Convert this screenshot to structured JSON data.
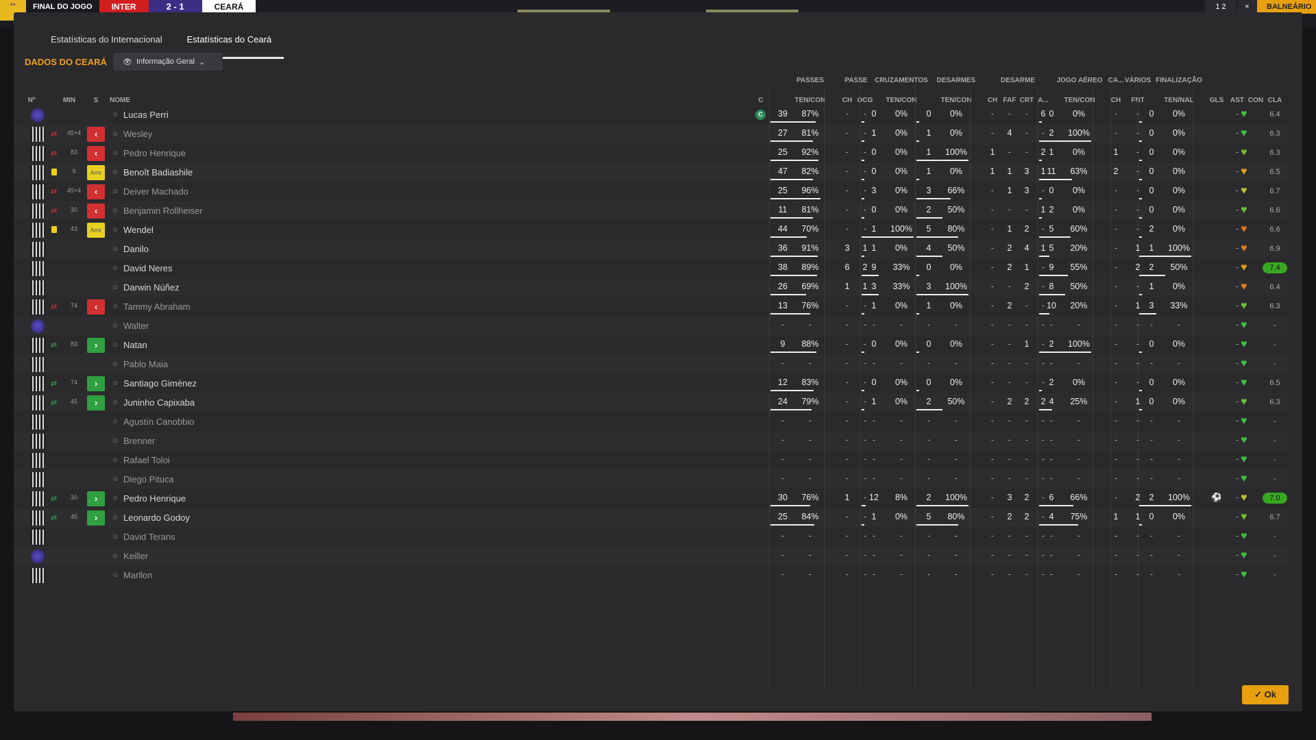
{
  "topbar": {
    "final_label": "FINAL DO JOGO",
    "home_team": "INTER",
    "score": "2 - 1",
    "away_team": "CEARÁ",
    "right_num": "1 2",
    "right_x": "×",
    "right_button": "BALNEÁRIO"
  },
  "tabs": [
    {
      "label": "Estatísticas do Internacional"
    },
    {
      "label": "Estatísticas do Ceará"
    }
  ],
  "section_title": "DADOS DO CEARÁ",
  "dropdown": {
    "label": "Informação Geral"
  },
  "groups": {
    "passes": "PASSES",
    "passe": "PASSE",
    "cruz": "CRUZAMENTOS",
    "desarmes": "DESARMES",
    "desarme": "DESARME",
    "aereo": "JOGO AÉREO",
    "ca": "CA...",
    "varios": "VÁRIOS",
    "final": "FINALIZAÇÃO"
  },
  "headers": {
    "num": "Nº",
    "min": "MIN",
    "s": "S",
    "nome": "NOME",
    "c": "C",
    "passes_tc": "TEN/CON",
    "ch": "CH",
    "ocg": "OCG",
    "cruz_tc": "TEN/CON",
    "des_tc": "TEN/CON",
    "d_ch": "CH",
    "faf": "FAF",
    "crt": "CRT",
    "a": "A...",
    "aer_tc": "TEN/CON",
    "ca_ch": "CH",
    "fnt": "FNT",
    "fin_tn": "TEN/NAL",
    "gls": "GLS",
    "ast": "AST",
    "con": "CON",
    "cla": "CLA"
  },
  "players": [
    {
      "name": "Lucas Perri",
      "kit": "gk",
      "min": "",
      "s": "",
      "card": false,
      "capt": "C",
      "p": [
        "39",
        "87%"
      ],
      "pch": "-",
      "ocg": "-",
      "cr": [
        "0",
        "0%"
      ],
      "de": [
        "0",
        "0%"
      ],
      "dch": "-",
      "faf": "-",
      "crt": "-",
      "da": "6",
      "ae": [
        "0",
        "0%"
      ],
      "cach": "-",
      "fnt": "-",
      "fi": [
        "0",
        "0%"
      ],
      "gls": "",
      "ast": "-",
      "con": "#40c040",
      "cla": "6.4",
      "hi": false,
      "bench": false
    },
    {
      "name": "Wesley",
      "kit": "out",
      "min": "45+4",
      "s": "off",
      "card": false,
      "capt": "",
      "p": [
        "27",
        "81%"
      ],
      "pch": "-",
      "ocg": "-",
      "cr": [
        "1",
        "0%"
      ],
      "de": [
        "1",
        "0%"
      ],
      "dch": "-",
      "faf": "4",
      "crt": "-",
      "da": "-",
      "ae": [
        "2",
        "100%"
      ],
      "cach": "-",
      "fnt": "-",
      "fi": [
        "0",
        "0%"
      ],
      "gls": "",
      "ast": "-",
      "con": "#40c040",
      "cla": "6.3",
      "hi": false,
      "bench": true
    },
    {
      "name": "Pedro Henrique",
      "kit": "out",
      "min": "83",
      "s": "off",
      "card": false,
      "capt": "",
      "p": [
        "25",
        "92%"
      ],
      "pch": "-",
      "ocg": "-",
      "cr": [
        "0",
        "0%"
      ],
      "de": [
        "1",
        "100%"
      ],
      "dch": "1",
      "faf": "-",
      "crt": "-",
      "da": "2",
      "ae": [
        "1",
        "0%"
      ],
      "cach": "1",
      "fnt": "-",
      "fi": [
        "0",
        "0%"
      ],
      "gls": "",
      "ast": "-",
      "con": "#70c030",
      "cla": "6.3",
      "hi": false,
      "bench": true
    },
    {
      "name": "Benoît Badiashile",
      "kit": "out",
      "min": "9",
      "s": "amr",
      "card": true,
      "capt": "",
      "p": [
        "47",
        "82%"
      ],
      "pch": "-",
      "ocg": "-",
      "cr": [
        "0",
        "0%"
      ],
      "de": [
        "1",
        "0%"
      ],
      "dch": "1",
      "faf": "1",
      "crt": "3",
      "da": "1",
      "ae": [
        "11",
        "63%"
      ],
      "cach": "2",
      "fnt": "-",
      "fi": [
        "0",
        "0%"
      ],
      "gls": "",
      "ast": "-",
      "con": "#e0a020",
      "cla": "6.5",
      "hi": false,
      "bench": false
    },
    {
      "name": "Deiver Machado",
      "kit": "out",
      "min": "45+4",
      "s": "off",
      "card": false,
      "capt": "",
      "p": [
        "25",
        "96%"
      ],
      "pch": "-",
      "ocg": "-",
      "cr": [
        "3",
        "0%"
      ],
      "de": [
        "3",
        "66%"
      ],
      "dch": "-",
      "faf": "1",
      "crt": "3",
      "da": "-",
      "ae": [
        "0",
        "0%"
      ],
      "cach": "-",
      "fnt": "-",
      "fi": [
        "0",
        "0%"
      ],
      "gls": "",
      "ast": "-",
      "con": "#c0c030",
      "cla": "6.7",
      "hi": false,
      "bench": true
    },
    {
      "name": "Benjamin Rollheiser",
      "kit": "out",
      "min": "30",
      "s": "off",
      "card": false,
      "capt": "",
      "p": [
        "11",
        "81%"
      ],
      "pch": "-",
      "ocg": "-",
      "cr": [
        "0",
        "0%"
      ],
      "de": [
        "2",
        "50%"
      ],
      "dch": "-",
      "faf": "-",
      "crt": "-",
      "da": "1",
      "ae": [
        "2",
        "0%"
      ],
      "cach": "-",
      "fnt": "-",
      "fi": [
        "0",
        "0%"
      ],
      "gls": "",
      "ast": "-",
      "con": "#70c030",
      "cla": "6.6",
      "hi": false,
      "bench": true
    },
    {
      "name": "Wendel",
      "kit": "out",
      "min": "43",
      "s": "amr",
      "card": true,
      "capt": "",
      "p": [
        "44",
        "70%"
      ],
      "pch": "-",
      "ocg": "-",
      "cr": [
        "1",
        "100%"
      ],
      "de": [
        "5",
        "80%"
      ],
      "dch": "-",
      "faf": "1",
      "crt": "2",
      "da": "-",
      "ae": [
        "5",
        "60%"
      ],
      "cach": "-",
      "fnt": "-",
      "fi": [
        "2",
        "0%"
      ],
      "gls": "",
      "ast": "-",
      "con": "#e07020",
      "cla": "6.6",
      "hi": false,
      "bench": false
    },
    {
      "name": "Danilo",
      "kit": "out",
      "min": "",
      "s": "",
      "card": false,
      "capt": "",
      "p": [
        "36",
        "91%"
      ],
      "pch": "3",
      "ocg": "1",
      "cr": [
        "1",
        "0%"
      ],
      "de": [
        "4",
        "50%"
      ],
      "dch": "-",
      "faf": "2",
      "crt": "4",
      "da": "1",
      "ae": [
        "5",
        "20%"
      ],
      "cach": "-",
      "fnt": "1",
      "fi": [
        "1",
        "100%"
      ],
      "gls": "",
      "ast": "-",
      "con": "#e08020",
      "cla": "6.9",
      "hi": false,
      "bench": false
    },
    {
      "name": "David Neres",
      "kit": "out",
      "min": "",
      "s": "",
      "card": false,
      "capt": "",
      "p": [
        "38",
        "89%"
      ],
      "pch": "6",
      "ocg": "2",
      "cr": [
        "9",
        "33%"
      ],
      "de": [
        "0",
        "0%"
      ],
      "dch": "-",
      "faf": "2",
      "crt": "1",
      "da": "-",
      "ae": [
        "9",
        "55%"
      ],
      "cach": "-",
      "fnt": "2",
      "fi": [
        "2",
        "50%"
      ],
      "gls": "",
      "ast": "-",
      "con": "#e0a020",
      "cla": "7.4",
      "hi": true,
      "bench": false
    },
    {
      "name": "Darwin Núñez",
      "kit": "out",
      "min": "",
      "s": "",
      "card": false,
      "capt": "",
      "p": [
        "26",
        "69%"
      ],
      "pch": "1",
      "ocg": "1",
      "cr": [
        "3",
        "33%"
      ],
      "de": [
        "3",
        "100%"
      ],
      "dch": "-",
      "faf": "-",
      "crt": "2",
      "da": "-",
      "ae": [
        "8",
        "50%"
      ],
      "cach": "-",
      "fnt": "-",
      "fi": [
        "1",
        "0%"
      ],
      "gls": "",
      "ast": "-",
      "con": "#e08020",
      "cla": "6.4",
      "hi": false,
      "bench": false
    },
    {
      "name": "Tammy Abraham",
      "kit": "out",
      "min": "74",
      "s": "off",
      "card": false,
      "capt": "",
      "p": [
        "13",
        "76%"
      ],
      "pch": "-",
      "ocg": "-",
      "cr": [
        "1",
        "0%"
      ],
      "de": [
        "1",
        "0%"
      ],
      "dch": "-",
      "faf": "2",
      "crt": "-",
      "da": "-",
      "ae": [
        "10",
        "20%"
      ],
      "cach": "-",
      "fnt": "1",
      "fi": [
        "3",
        "33%"
      ],
      "gls": "",
      "ast": "-",
      "con": "#70c030",
      "cla": "6.3",
      "hi": false,
      "bench": true
    },
    {
      "name": "Walter",
      "kit": "gk",
      "min": "",
      "s": "",
      "card": false,
      "capt": "",
      "p": [
        "-",
        "-"
      ],
      "pch": "-",
      "ocg": "-",
      "cr": [
        "-",
        "-"
      ],
      "de": [
        "-",
        "-"
      ],
      "dch": "-",
      "faf": "-",
      "crt": "-",
      "da": "-",
      "ae": [
        "-",
        "-"
      ],
      "cach": "-",
      "fnt": "-",
      "fi": [
        "-",
        "-"
      ],
      "gls": "",
      "ast": "-",
      "con": "#40c040",
      "cla": "-",
      "hi": false,
      "bench": true
    },
    {
      "name": "Natan",
      "kit": "out",
      "min": "83",
      "s": "on",
      "card": false,
      "capt": "",
      "p": [
        "9",
        "88%"
      ],
      "pch": "-",
      "ocg": "-",
      "cr": [
        "0",
        "0%"
      ],
      "de": [
        "0",
        "0%"
      ],
      "dch": "-",
      "faf": "-",
      "crt": "1",
      "da": "-",
      "ae": [
        "2",
        "100%"
      ],
      "cach": "-",
      "fnt": "-",
      "fi": [
        "0",
        "0%"
      ],
      "gls": "",
      "ast": "-",
      "con": "#40c040",
      "cla": "-",
      "hi": false,
      "bench": false
    },
    {
      "name": "Pablo Maia",
      "kit": "out",
      "min": "",
      "s": "",
      "card": false,
      "capt": "",
      "p": [
        "-",
        "-"
      ],
      "pch": "-",
      "ocg": "-",
      "cr": [
        "-",
        "-"
      ],
      "de": [
        "-",
        "-"
      ],
      "dch": "-",
      "faf": "-",
      "crt": "-",
      "da": "-",
      "ae": [
        "-",
        "-"
      ],
      "cach": "-",
      "fnt": "-",
      "fi": [
        "-",
        "-"
      ],
      "gls": "",
      "ast": "-",
      "con": "#40c040",
      "cla": "-",
      "hi": false,
      "bench": true
    },
    {
      "name": "Santiago Giménez",
      "kit": "out",
      "min": "74",
      "s": "on",
      "card": false,
      "capt": "",
      "p": [
        "12",
        "83%"
      ],
      "pch": "-",
      "ocg": "-",
      "cr": [
        "0",
        "0%"
      ],
      "de": [
        "0",
        "0%"
      ],
      "dch": "-",
      "faf": "-",
      "crt": "-",
      "da": "-",
      "ae": [
        "2",
        "0%"
      ],
      "cach": "-",
      "fnt": "-",
      "fi": [
        "0",
        "0%"
      ],
      "gls": "",
      "ast": "-",
      "con": "#40c040",
      "cla": "6.5",
      "hi": false,
      "bench": false
    },
    {
      "name": "Juninho Capixaba",
      "kit": "out",
      "min": "45",
      "s": "on",
      "card": false,
      "capt": "",
      "p": [
        "24",
        "79%"
      ],
      "pch": "-",
      "ocg": "-",
      "cr": [
        "1",
        "0%"
      ],
      "de": [
        "2",
        "50%"
      ],
      "dch": "-",
      "faf": "2",
      "crt": "2",
      "da": "2",
      "ae": [
        "4",
        "25%"
      ],
      "cach": "-",
      "fnt": "1",
      "fi": [
        "0",
        "0%"
      ],
      "gls": "",
      "ast": "-",
      "con": "#70c030",
      "cla": "6.3",
      "hi": false,
      "bench": false
    },
    {
      "name": "Agustín Canobbio",
      "kit": "out",
      "min": "",
      "s": "",
      "card": false,
      "capt": "",
      "p": [
        "-",
        "-"
      ],
      "pch": "-",
      "ocg": "-",
      "cr": [
        "-",
        "-"
      ],
      "de": [
        "-",
        "-"
      ],
      "dch": "-",
      "faf": "-",
      "crt": "-",
      "da": "-",
      "ae": [
        "-",
        "-"
      ],
      "cach": "-",
      "fnt": "-",
      "fi": [
        "-",
        "-"
      ],
      "gls": "",
      "ast": "-",
      "con": "#40c040",
      "cla": "-",
      "hi": false,
      "bench": true
    },
    {
      "name": "Brenner",
      "kit": "out",
      "min": "",
      "s": "",
      "card": false,
      "capt": "",
      "p": [
        "-",
        "-"
      ],
      "pch": "-",
      "ocg": "-",
      "cr": [
        "-",
        "-"
      ],
      "de": [
        "-",
        "-"
      ],
      "dch": "-",
      "faf": "-",
      "crt": "-",
      "da": "-",
      "ae": [
        "-",
        "-"
      ],
      "cach": "-",
      "fnt": "-",
      "fi": [
        "-",
        "-"
      ],
      "gls": "",
      "ast": "-",
      "con": "#40c040",
      "cla": "-",
      "hi": false,
      "bench": true
    },
    {
      "name": "Rafael Toloi",
      "kit": "out",
      "min": "",
      "s": "",
      "card": false,
      "capt": "",
      "p": [
        "-",
        "-"
      ],
      "pch": "-",
      "ocg": "-",
      "cr": [
        "-",
        "-"
      ],
      "de": [
        "-",
        "-"
      ],
      "dch": "-",
      "faf": "-",
      "crt": "-",
      "da": "-",
      "ae": [
        "-",
        "-"
      ],
      "cach": "-",
      "fnt": "-",
      "fi": [
        "-",
        "-"
      ],
      "gls": "",
      "ast": "-",
      "con": "#40c040",
      "cla": "-",
      "hi": false,
      "bench": true
    },
    {
      "name": "Diego Pituca",
      "kit": "out",
      "min": "",
      "s": "",
      "card": false,
      "capt": "",
      "p": [
        "-",
        "-"
      ],
      "pch": "-",
      "ocg": "-",
      "cr": [
        "-",
        "-"
      ],
      "de": [
        "-",
        "-"
      ],
      "dch": "-",
      "faf": "-",
      "crt": "-",
      "da": "-",
      "ae": [
        "-",
        "-"
      ],
      "cach": "-",
      "fnt": "-",
      "fi": [
        "-",
        "-"
      ],
      "gls": "",
      "ast": "-",
      "con": "#40c040",
      "cla": "-",
      "hi": false,
      "bench": true
    },
    {
      "name": "Pedro Henrique",
      "kit": "out",
      "min": "30",
      "s": "on",
      "card": false,
      "capt": "",
      "p": [
        "30",
        "76%"
      ],
      "pch": "1",
      "ocg": "-",
      "cr": [
        "12",
        "8%"
      ],
      "de": [
        "2",
        "100%"
      ],
      "dch": "-",
      "faf": "3",
      "crt": "2",
      "da": "-",
      "ae": [
        "6",
        "66%"
      ],
      "cach": "-",
      "fnt": "2",
      "fi": [
        "2",
        "100%"
      ],
      "gls": "⚽",
      "ast": "-",
      "con": "#c0c030",
      "cla": "7.0",
      "hi": true,
      "bench": false
    },
    {
      "name": "Leonardo Godoy",
      "kit": "out",
      "min": "45",
      "s": "on",
      "card": false,
      "capt": "",
      "p": [
        "25",
        "84%"
      ],
      "pch": "-",
      "ocg": "-",
      "cr": [
        "1",
        "0%"
      ],
      "de": [
        "5",
        "80%"
      ],
      "dch": "-",
      "faf": "2",
      "crt": "2",
      "da": "-",
      "ae": [
        "4",
        "75%"
      ],
      "cach": "1",
      "fnt": "1",
      "fi": [
        "0",
        "0%"
      ],
      "gls": "",
      "ast": "-",
      "con": "#70c030",
      "cla": "6.7",
      "hi": false,
      "bench": false
    },
    {
      "name": "David Terans",
      "kit": "out",
      "min": "",
      "s": "",
      "card": false,
      "capt": "",
      "p": [
        "-",
        "-"
      ],
      "pch": "-",
      "ocg": "-",
      "cr": [
        "-",
        "-"
      ],
      "de": [
        "-",
        "-"
      ],
      "dch": "-",
      "faf": "-",
      "crt": "-",
      "da": "-",
      "ae": [
        "-",
        "-"
      ],
      "cach": "-",
      "fnt": "-",
      "fi": [
        "-",
        "-"
      ],
      "gls": "",
      "ast": "-",
      "con": "#40c040",
      "cla": "-",
      "hi": false,
      "bench": true
    },
    {
      "name": "Keiller",
      "kit": "gk",
      "min": "",
      "s": "",
      "card": false,
      "capt": "",
      "p": [
        "-",
        "-"
      ],
      "pch": "-",
      "ocg": "-",
      "cr": [
        "-",
        "-"
      ],
      "de": [
        "-",
        "-"
      ],
      "dch": "-",
      "faf": "-",
      "crt": "-",
      "da": "-",
      "ae": [
        "-",
        "-"
      ],
      "cach": "-",
      "fnt": "-",
      "fi": [
        "-",
        "-"
      ],
      "gls": "",
      "ast": "-",
      "con": "#40c040",
      "cla": "-",
      "hi": false,
      "bench": true
    },
    {
      "name": "Marllon",
      "kit": "out",
      "min": "",
      "s": "",
      "card": false,
      "capt": "",
      "p": [
        "-",
        "-"
      ],
      "pch": "-",
      "ocg": "-",
      "cr": [
        "-",
        "-"
      ],
      "de": [
        "-",
        "-"
      ],
      "dch": "-",
      "faf": "-",
      "crt": "-",
      "da": "-",
      "ae": [
        "-",
        "-"
      ],
      "cach": "-",
      "fnt": "-",
      "fi": [
        "-",
        "-"
      ],
      "gls": "",
      "ast": "-",
      "con": "#40c040",
      "cla": "-",
      "hi": false,
      "bench": true
    }
  ],
  "ok_button": "Ok"
}
